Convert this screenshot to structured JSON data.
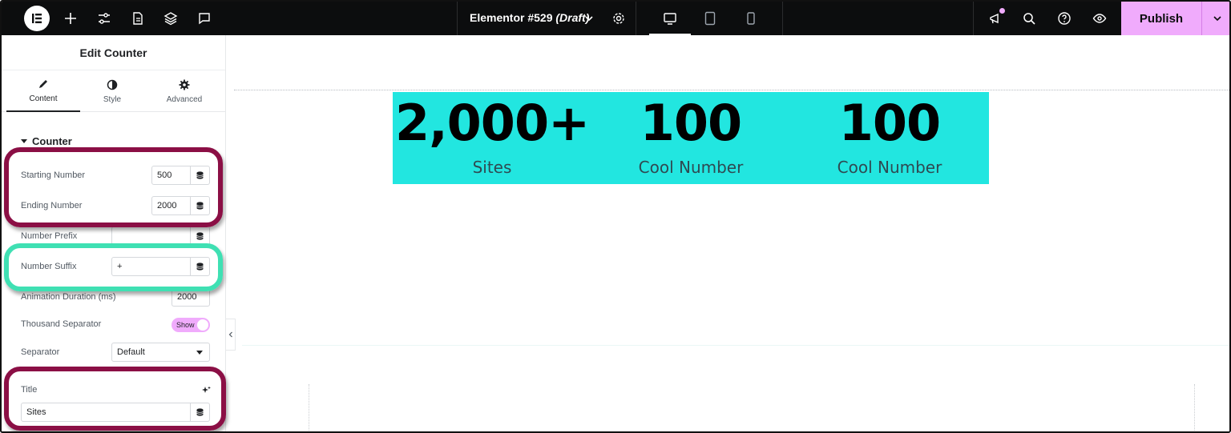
{
  "topbar": {
    "doc_name": "Elementor #529",
    "doc_status": "(Draft)",
    "publish_label": "Publish"
  },
  "panel": {
    "title": "Edit Counter",
    "tabs": [
      {
        "label": "Content",
        "icon": "pencil-icon",
        "active": true
      },
      {
        "label": "Style",
        "icon": "half-circle-icon",
        "active": false
      },
      {
        "label": "Advanced",
        "icon": "gear-icon",
        "active": false
      }
    ],
    "section": "Counter",
    "fields": {
      "starting_number": {
        "label": "Starting Number",
        "value": "500"
      },
      "ending_number": {
        "label": "Ending Number",
        "value": "2000"
      },
      "number_prefix": {
        "label": "Number Prefix",
        "value": ""
      },
      "number_suffix": {
        "label": "Number Suffix",
        "value": "+"
      },
      "animation_duration": {
        "label": "Animation Duration (ms)",
        "value": "2000"
      },
      "thousand_separator": {
        "label": "Thousand Separator",
        "toggle": "Show"
      },
      "separator": {
        "label": "Separator",
        "value": "Default"
      },
      "title": {
        "label": "Title",
        "value": "Sites"
      }
    }
  },
  "canvas": {
    "background_color": "#22e6e0",
    "counters": [
      {
        "number": "2,000+",
        "title": "Sites"
      },
      {
        "number": "100",
        "title": "Cool Number"
      },
      {
        "number": "100",
        "title": "Cool Number"
      }
    ]
  },
  "colors": {
    "topbar": "#0c0d0e",
    "publish": "#f0abfc",
    "highlight_maroon": "#8b0f45",
    "highlight_green": "#3fe0b3"
  }
}
